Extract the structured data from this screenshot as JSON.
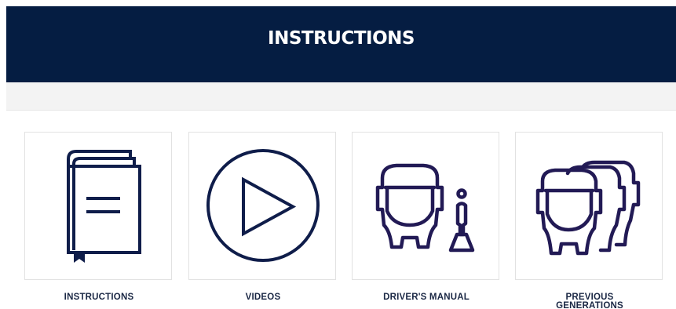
{
  "header": {
    "title": "INSTRUCTIONS"
  },
  "colors": {
    "header_bg": "#051d42",
    "icon_stroke": "#0f1d4a",
    "label_text": "#1a2744"
  },
  "cards": [
    {
      "label": "INSTRUCTIONS",
      "icon": "book-icon"
    },
    {
      "label": "VIDEOS",
      "icon": "play-icon"
    },
    {
      "label": "DRIVER'S MANUAL",
      "icon": "truck-driver-icon"
    },
    {
      "label_line1": "PREVIOUS",
      "label_line2": "GENERATIONS",
      "icon": "truck-fleet-icon"
    }
  ]
}
